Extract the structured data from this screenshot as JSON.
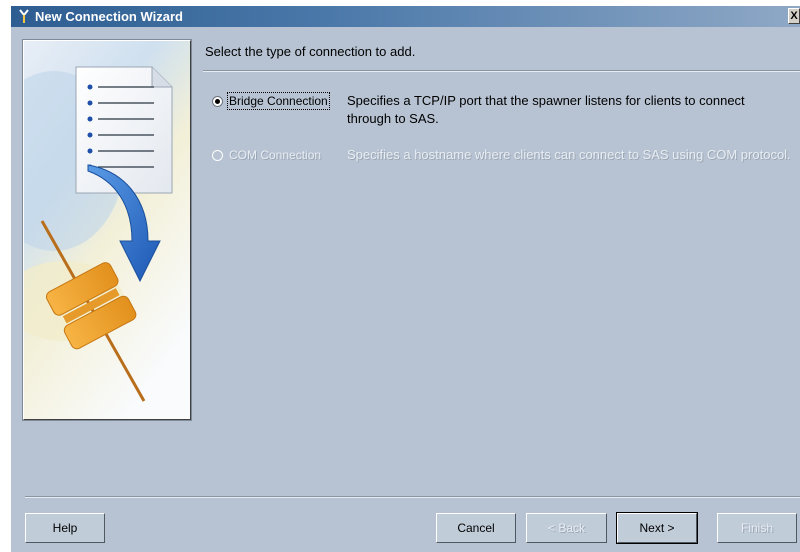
{
  "window": {
    "title": "New Connection Wizard",
    "close_glyph": "X"
  },
  "main": {
    "heading": "Select the type of connection to add.",
    "options": [
      {
        "label": "Bridge Connection",
        "description": "Specifies a TCP/IP port that the spawner listens for clients to connect through to SAS.",
        "selected": true,
        "enabled": true
      },
      {
        "label": "COM Connection",
        "description": "Specifies a hostname where clients can connect to SAS using COM protocol.",
        "selected": false,
        "enabled": false
      }
    ]
  },
  "buttons": {
    "help": "Help",
    "cancel": "Cancel",
    "back": "< Back",
    "next": "Next >",
    "finish": "Finish"
  },
  "colors": {
    "title_bar": "#2d5d91",
    "dialog_bg": "#b7c3d2",
    "arrow_blue": "#2c6fc9",
    "connector_orange": "#f5a623"
  },
  "icons": [
    "wizard-title-icon",
    "document-icon",
    "curved-arrow-icon",
    "plug-connector-icon"
  ]
}
